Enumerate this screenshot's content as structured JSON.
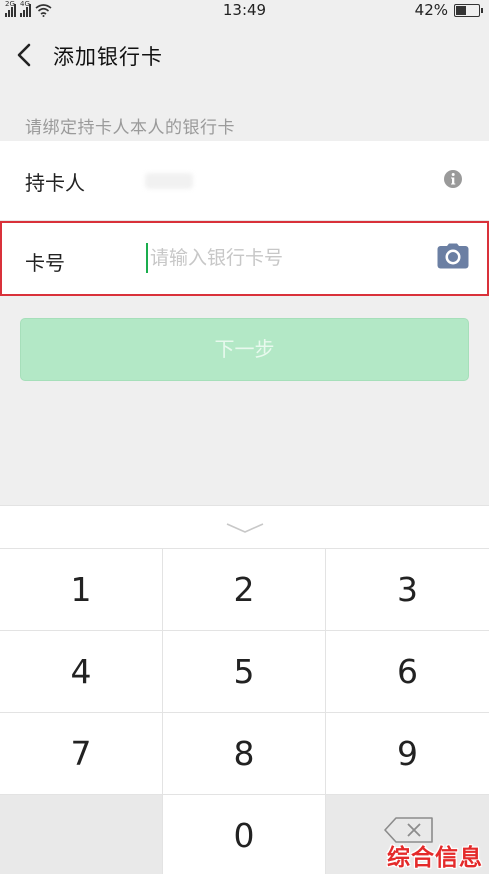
{
  "status_bar": {
    "network_1": "2G",
    "network_2": "4G",
    "time": "13:49",
    "battery_percent": "42%",
    "battery_level": 0.42
  },
  "nav": {
    "title": "添加银行卡"
  },
  "form": {
    "hint": "请绑定持卡人本人的银行卡",
    "holder_label": "持卡人",
    "card_label": "卡号",
    "card_placeholder": "请输入银行卡号",
    "next_label": "下一步"
  },
  "keyboard": {
    "keys": [
      "1",
      "2",
      "3",
      "4",
      "5",
      "6",
      "7",
      "8",
      "9",
      "",
      "0",
      ""
    ]
  },
  "watermark": "综合信息",
  "colors": {
    "highlight_border": "#d9313a",
    "cursor": "#1aad4d",
    "next_button_disabled": "#b3e8c6",
    "camera_icon": "#6b7fa3"
  },
  "icons": {
    "back": "chevron-left-icon",
    "info": "info-icon",
    "camera": "camera-icon",
    "collapse": "chevron-down-icon",
    "delete": "backspace-icon"
  }
}
